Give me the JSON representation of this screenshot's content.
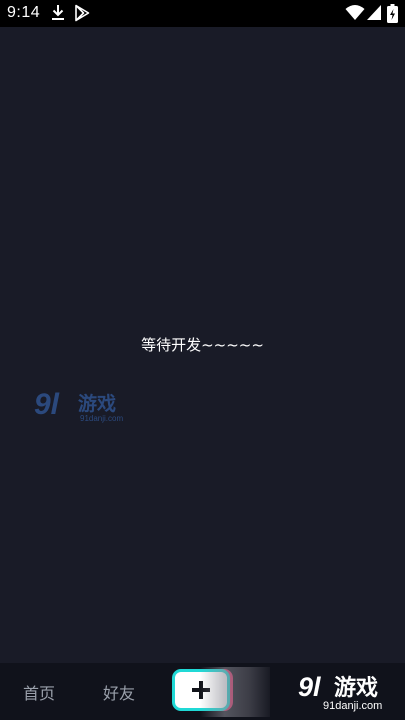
{
  "status_bar": {
    "time": "9:14",
    "icons": [
      "download-icon",
      "play-store-icon",
      "wifi-icon",
      "signal-icon",
      "battery-icon"
    ]
  },
  "main": {
    "message": "等待开发~~~~~"
  },
  "bottom_nav": {
    "tabs": [
      {
        "label": "首页"
      },
      {
        "label": "好友"
      }
    ],
    "add_button_icon": "plus-icon"
  },
  "watermark": {
    "brand_number": "9l",
    "brand_text": "游戏",
    "domain": "91danji.com"
  },
  "colors": {
    "background": "#191b27",
    "status_bar": "#000000",
    "nav_bar": "#10121b",
    "nav_text": "#9aa0ab",
    "accent_cyan": "#20d9d6",
    "accent_pink": "#e8336c"
  }
}
